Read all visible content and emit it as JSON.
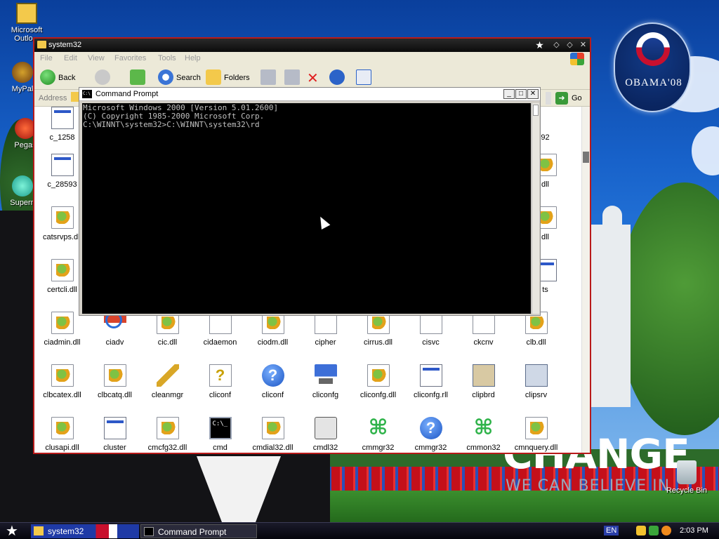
{
  "desktop": {
    "icons": [
      {
        "label": "Microsoft Outlo..."
      },
      {
        "label": "MyPal"
      },
      {
        "label": "Pegas"
      },
      {
        "label": "Supern"
      }
    ],
    "recycle_bin": {
      "label": "Recycle Bin"
    },
    "logo": {
      "text": "OBAMA'08"
    },
    "slogan": {
      "title": "CHANGE",
      "subtitle": "WE CAN BELIEVE IN"
    }
  },
  "explorer": {
    "title": "system32",
    "menu": [
      "File",
      "Edit",
      "View",
      "Favorites",
      "Tools",
      "Help"
    ],
    "toolbar": {
      "back": "Back",
      "search": "Search",
      "folders": "Folders"
    },
    "address_label": "Address",
    "go_label": "Go",
    "files": [
      [
        "c_1258",
        "",
        "",
        "",
        "",
        "",
        "",
        "",
        "",
        "92"
      ],
      [
        "c_28593",
        "",
        "",
        "",
        "",
        "",
        "",
        "",
        "",
        "dll"
      ],
      [
        "catsrvps.dll",
        "",
        "",
        "",
        "",
        "",
        "",
        "",
        "",
        "dll"
      ],
      [
        "certcli.dll",
        "",
        "",
        "",
        "",
        "",
        "",
        "",
        "",
        "ts"
      ],
      [
        "ciadmin.dll",
        "ciadv",
        "cic.dll",
        "cidaemon",
        "ciodm.dll",
        "cipher",
        "cirrus.dll",
        "cisvc",
        "ckcnv",
        "clb.dll"
      ],
      [
        "clbcatex.dll",
        "clbcatq.dll",
        "cleanmgr",
        "cliconf",
        "cliconf",
        "cliconfg",
        "cliconfg.dll",
        "cliconfg.rll",
        "clipbrd",
        "clipsrv"
      ],
      [
        "clusapi.dll",
        "cluster",
        "cmcfg32.dll",
        "cmd",
        "cmdial32.dll",
        "cmdl32",
        "cmmgr32",
        "cmmgr32",
        "cmmon32",
        "cmnquery.dll"
      ]
    ]
  },
  "cmd": {
    "title": "Command Prompt",
    "lines": [
      "Microsoft Windows 2000 [Version 5.01.2600]",
      "(C) Copyright 1985-2000 Microsoft Corp.",
      "",
      "C:\\WINNT\\system32>C:\\WINNT\\system32\\rd"
    ]
  },
  "taskbar": {
    "tasks": [
      {
        "label": "system32"
      },
      {
        "label": "Command Prompt"
      }
    ],
    "language": "EN",
    "clock": "2:03 PM"
  }
}
